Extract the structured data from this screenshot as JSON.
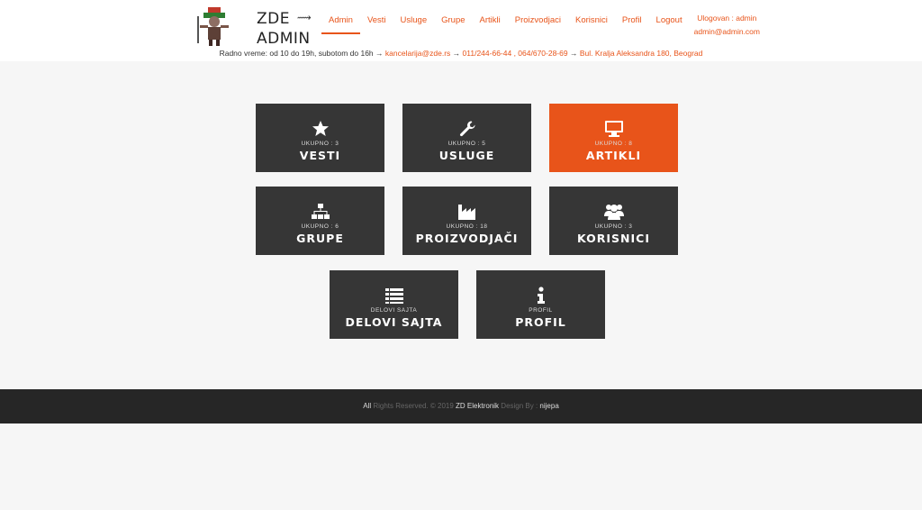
{
  "brand": {
    "line1": "ZDE",
    "line2": "ADMIN",
    "arrow": "⟿"
  },
  "nav": [
    {
      "label": "Admin"
    },
    {
      "label": "Vesti"
    },
    {
      "label": "Usluge"
    },
    {
      "label": "Grupe"
    },
    {
      "label": "Artikli"
    },
    {
      "label": "Proizvodjaci"
    },
    {
      "label": "Korisnici"
    },
    {
      "label": "Profil"
    },
    {
      "label": "Logout"
    }
  ],
  "user": {
    "logged": "Ulogovan : admin",
    "email": "admin@admin.com"
  },
  "info": {
    "hours": "Radno vreme: od 10 do 19h, subotom do 16h",
    "email": "kancelarija@zde.rs",
    "phones": "011/244-66-44 , 064/670-28-69",
    "address": "Bul. Kralja Aleksandra 180, Beograd",
    "sep": " → "
  },
  "tiles": [
    {
      "sub": "UKUPNO : 3",
      "name": "VESTI",
      "icon": "star-icon"
    },
    {
      "sub": "UKUPNO : 5",
      "name": "USLUGE",
      "icon": "wrench-icon"
    },
    {
      "sub": "UKUPNO : 8",
      "name": "ARTIKLI",
      "icon": "monitor-icon"
    },
    {
      "sub": "UKUPNO : 6",
      "name": "GRUPE",
      "icon": "sitemap-icon"
    },
    {
      "sub": "UKUPNO : 18",
      "name": "PROIZVODJAČI",
      "icon": "factory-icon"
    },
    {
      "sub": "UKUPNO : 3",
      "name": "KORISNICI",
      "icon": "users-icon"
    },
    {
      "sub": "DELOVI SAJTA",
      "name": "DELOVI SAJTA",
      "icon": "list-icon"
    },
    {
      "sub": "PROFIL",
      "name": "PROFIL",
      "icon": "info-icon"
    }
  ],
  "footer": {
    "all": "All",
    "rights": " Rights Reserved. © 2019 ",
    "company": "ZD Elektronik",
    "design": " Design By : ",
    "designer": "nijepa"
  },
  "colors": {
    "accent": "#e8541a",
    "tile": "#363636",
    "footer": "#262626"
  }
}
